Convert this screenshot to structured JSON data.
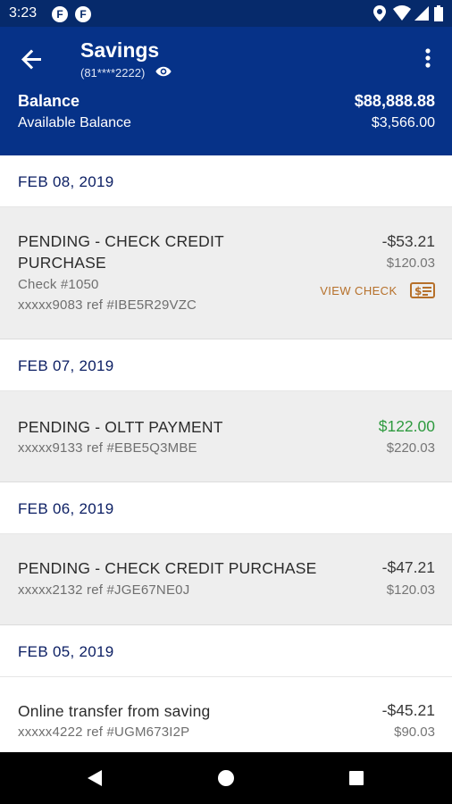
{
  "status_bar": {
    "time": "3:23",
    "left_icons": [
      "F",
      "F"
    ],
    "right_icons": [
      "location-icon",
      "wifi-icon",
      "signal-icon",
      "battery-icon"
    ]
  },
  "header": {
    "title": "Savings",
    "account_mask": "(81****2222)",
    "balance_label": "Balance",
    "balance_value": "$88,888.88",
    "available_label": "Available Balance",
    "available_value": "$3,566.00"
  },
  "groups": [
    {
      "date": "FEB 08, 2019",
      "txn": {
        "desc_line1": "PENDING - CHECK CREDIT",
        "desc_line2": "PURCHASE",
        "check": "Check #1050",
        "ref": "xxxxx9083 ref #IBE5R29VZC",
        "amount": "-$53.21",
        "running_balance": "$120.03",
        "action": "VIEW CHECK"
      }
    },
    {
      "date": "FEB 07, 2019",
      "txn": {
        "desc": "PENDING - OLTT PAYMENT",
        "ref": "xxxxx9133 ref #EBE5Q3MBE",
        "amount": "$122.00",
        "running_balance": "$220.03"
      }
    },
    {
      "date": "FEB 06, 2019",
      "txn": {
        "desc": "PENDING - CHECK CREDIT PURCHASE",
        "ref": "xxxxx2132 ref #JGE67NE0J",
        "amount": "-$47.21",
        "running_balance": "$120.03"
      }
    },
    {
      "date": "FEB 05, 2019",
      "txn": {
        "desc": "Online transfer from saving",
        "ref": "xxxxx4222 ref #UGM673I2P",
        "amount": "-$45.21",
        "running_balance": "$90.03"
      }
    }
  ],
  "colors": {
    "header": "#063288",
    "status": "#062a6b",
    "positive": "#2e9a3f",
    "accent": "#b6702a",
    "date_text": "#0b1e63"
  }
}
